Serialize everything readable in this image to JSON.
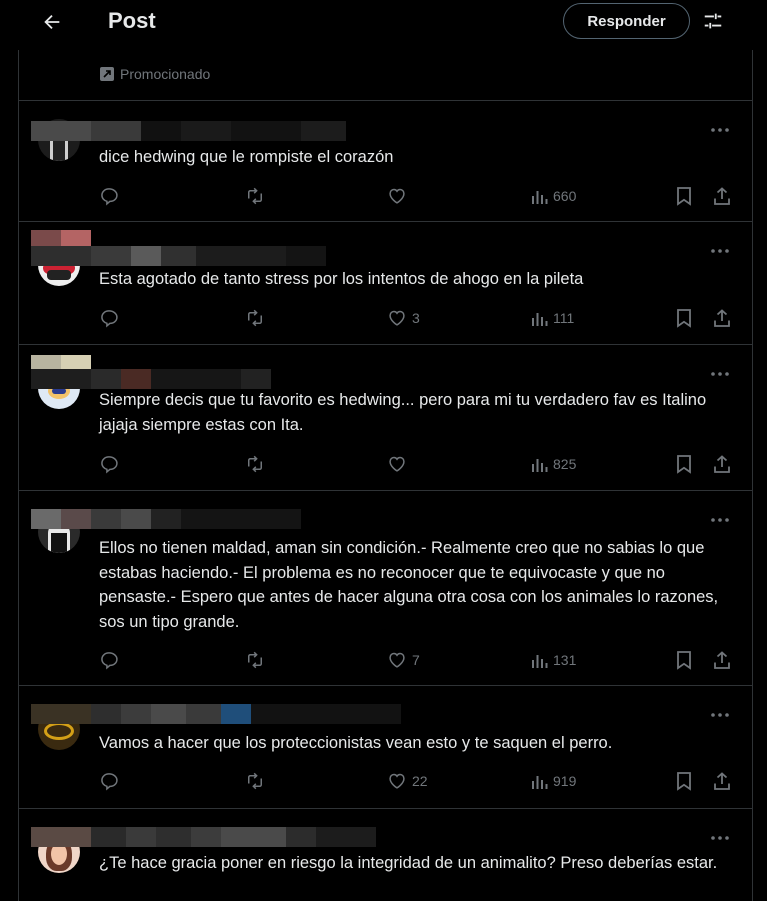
{
  "header": {
    "title": "Post",
    "reply_button": "Responder",
    "promoted_label": "Promocionado"
  },
  "replies": [
    {
      "text": "dice hedwing que le rompiste el corazón",
      "likes": "",
      "views": "660"
    },
    {
      "text": "Esta agotado de tanto stress por los intentos de ahogo en la pileta",
      "likes": "3",
      "views": "111"
    },
    {
      "text": "Siempre decis que tu favorito es hedwing... pero para mi tu verdadero fav es Italino jajaja siempre estas con Ita.",
      "likes": "",
      "views": "825"
    },
    {
      "text": "Ellos no tienen maldad, aman sin condición.- Realmente creo que no sabias lo que estabas haciendo.- El problema es no reconocer que te equivocaste y que no pensaste.- Espero que antes de hacer alguna otra cosa con los animales lo razones, sos un tipo grande.",
      "likes": "7",
      "views": "131"
    },
    {
      "text": "Vamos a hacer que los proteccionistas vean esto y te saquen el perro.",
      "likes": "22",
      "views": "919"
    },
    {
      "text": "¿Te hace gracia poner en riesgo la integridad de un animalito? Preso deberías estar.",
      "likes": "",
      "views": ""
    }
  ],
  "colors": {
    "background": "#000000",
    "text": "#e7e9ea",
    "muted": "#71767b",
    "border": "#2f3336"
  }
}
